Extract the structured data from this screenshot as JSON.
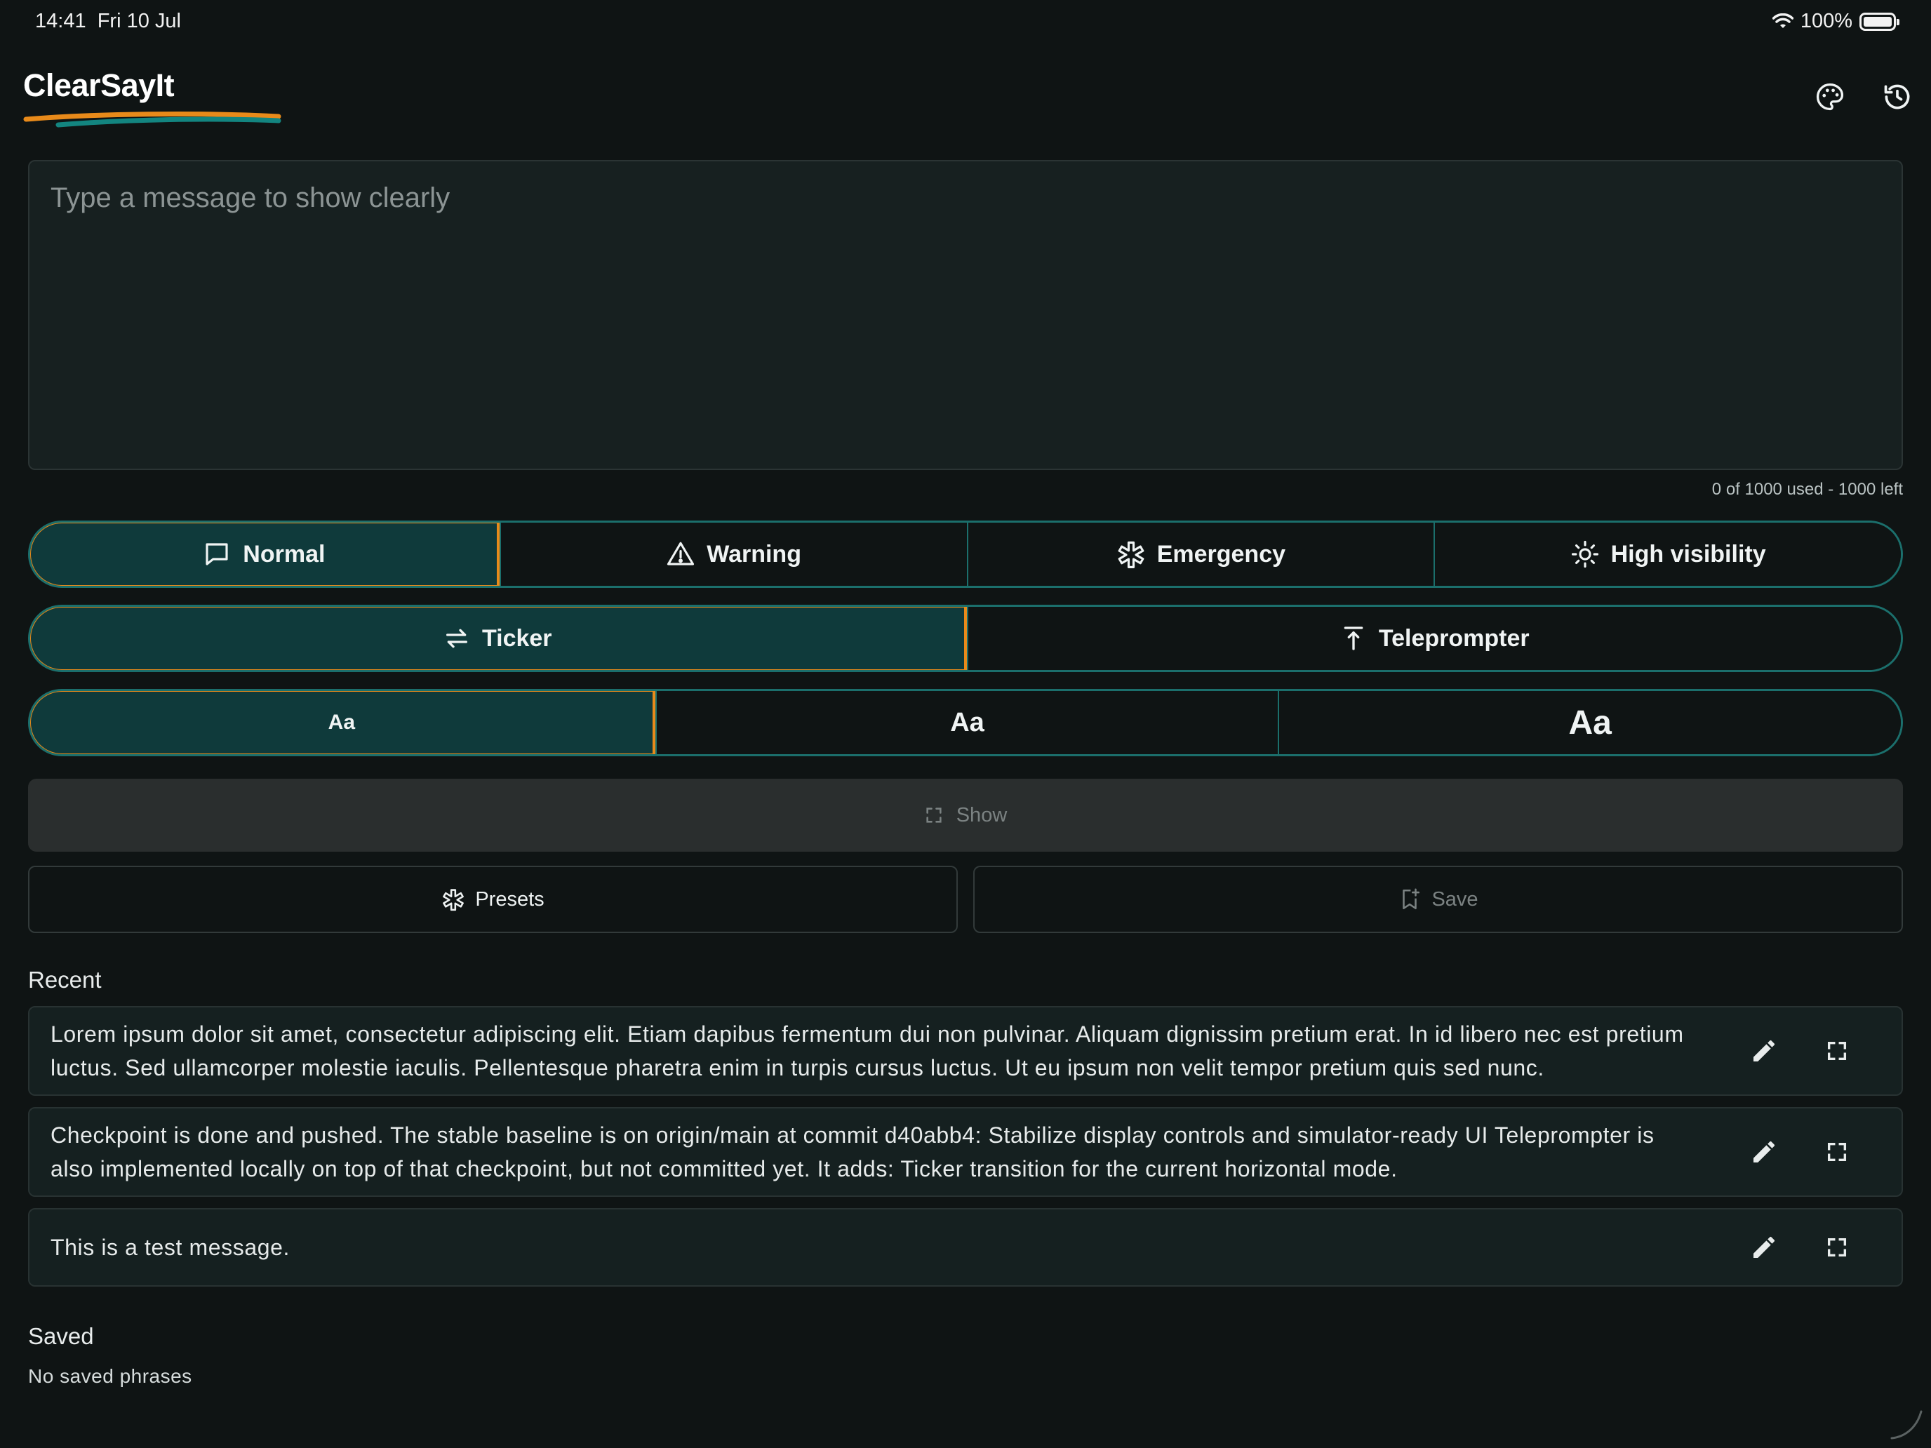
{
  "status_bar": {
    "time": "14:41",
    "date": "Fri 10 Jul",
    "battery": "100%"
  },
  "header": {
    "app_title": "ClearSayIt"
  },
  "message": {
    "placeholder": "Type a message to show clearly",
    "value": "",
    "char_count": "0 of 1000 used - 1000 left"
  },
  "tone_selector": {
    "options": [
      "Normal",
      "Warning",
      "Emergency",
      "High visibility"
    ],
    "selected": "Normal"
  },
  "mode_selector": {
    "options": [
      "Ticker",
      "Teleprompter"
    ],
    "selected": "Ticker"
  },
  "size_selector": {
    "options": [
      "Aa",
      "Aa",
      "Aa"
    ],
    "selected_index": 0
  },
  "show_button": {
    "label": "Show"
  },
  "presets_button": {
    "label": "Presets"
  },
  "save_button": {
    "label": "Save"
  },
  "recent": {
    "title": "Recent",
    "items": [
      {
        "text": "Lorem ipsum dolor sit amet, consectetur adipiscing elit. Etiam dapibus fermentum dui non pulvinar. Aliquam dignissim pretium erat. In id libero nec est pretium luctus. Sed ullamcorper molestie iaculis. Pellentesque pharetra enim in turpis cursus luctus. Ut eu ipsum non velit tempor pretium quis sed nunc."
      },
      {
        "text": "Checkpoint is done and pushed. The stable baseline is on origin/main at commit d40abb4: Stabilize display controls and simulator-ready UI Teleprompter is also implemented locally on top of that checkpoint, but not committed yet. It adds: Ticker transition for the current horizontal mode."
      },
      {
        "text": "This is a test message."
      }
    ]
  },
  "saved": {
    "title": "Saved",
    "empty_text": "No saved phrases"
  },
  "colors": {
    "background": "#0f1414",
    "accent": "#e88a1a",
    "teal": "#1b6f6c",
    "selected_fill": "#0f3a3b"
  }
}
